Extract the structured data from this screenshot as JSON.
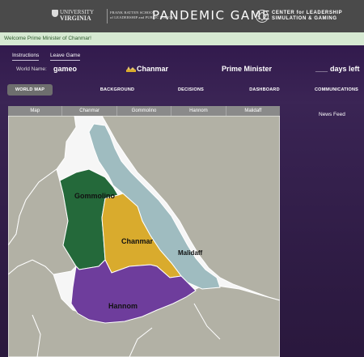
{
  "header": {
    "uva_logo_line1": "UNIVERSITY",
    "uva_logo_line2": "VIRGINIA",
    "batten_logo_line1": "FRANK BATTEN SCHOOL",
    "batten_logo_line2": "of LEADERSHIP and PUBLIC POLICY",
    "game_title": "PANDEMIC GAME",
    "center_logo_line1": "CENTER for LEADERSHIP",
    "center_logo_line2": "SIMULATION & GAMING"
  },
  "welcome_message": "Welcome Prime Minister of Chanmar!",
  "nav": {
    "instructions_label": "Instructions",
    "leave_game_label": "Leave Game"
  },
  "status": {
    "world_name_label": "World Name:",
    "world_name_value": "gameo",
    "country": "Chanmar",
    "role": "Prime Minister",
    "days_value": "___",
    "days_label": "days left"
  },
  "main_tabs": [
    "WORLD MAP",
    "BACKGROUND",
    "DECISIONS",
    "DASHBOARD",
    "COMMUNICATIONS"
  ],
  "active_tab": "WORLD MAP",
  "map_tabs": [
    "Map",
    "Chanmar",
    "Gommolino",
    "Hannom",
    "Malidaff"
  ],
  "news_feed_label": "News Feed",
  "map_labels": {
    "gommolino": "Gommolino",
    "chanmar": "Chanmar",
    "malidaff": "Malidaff",
    "hannom": "Hannom"
  },
  "colors": {
    "gommolino": "#24693a",
    "chanmar": "#d9ab2d",
    "malidaff": "#9fbcc0",
    "hannom": "#6e3d9c",
    "land": "#b2b1a5",
    "sea": "#f6f6f6",
    "header_bg": "#4a4a4a",
    "welcome_bg": "#d6e9d2",
    "purple_bg": "#3a2452"
  }
}
